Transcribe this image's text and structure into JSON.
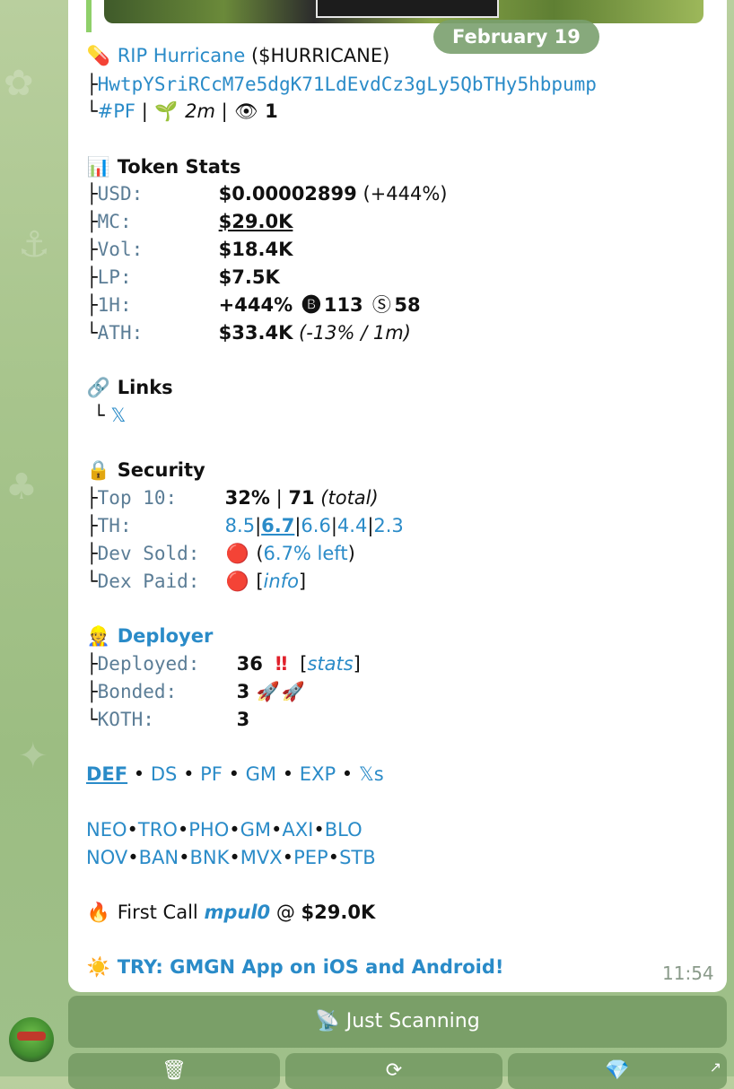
{
  "chat": {
    "date_pill": "February 19",
    "token": {
      "icon": "pill-icon",
      "name": "RIP Hurricane",
      "ticker": "($HURRICANE)",
      "contract_address": "HwtpYSriRCcM7e5dgK71LdEvdCz3gLy5QbTHy5hbpump",
      "platform_tag": "#PF",
      "age": "2m",
      "views": "1"
    },
    "token_stats": {
      "title": "Token Stats",
      "usd_label": "USD:",
      "usd_value": "$0.00002899",
      "usd_change": "(+444%)",
      "mc_label": "MC:",
      "mc_value": "$29.0K",
      "vol_label": "Vol:",
      "vol_value": "$18.4K",
      "lp_label": "LP:",
      "lp_value": "$7.5K",
      "h1_label": "1H:",
      "h1_change": "+444%",
      "h1_buys": "113",
      "h1_sells": "58",
      "ath_label": "ATH:",
      "ath_value": "$33.4K",
      "ath_note": "(-13% / 1m)"
    },
    "links": {
      "title": "Links",
      "x_link": "𝕏"
    },
    "security": {
      "title": "Security",
      "top10_label": "Top 10:",
      "top10_value": "32%",
      "top10_total": "71",
      "top10_total_note": "(total)",
      "th_label": "TH:",
      "th_values": [
        "8.5",
        "6.7",
        "6.6",
        "4.4",
        "2.3"
      ],
      "dev_sold_label": "Dev Sold:",
      "dev_sold_left": "6.7% left",
      "dex_paid_label": "Dex Paid:",
      "dex_paid_info": "info"
    },
    "deployer": {
      "title": "Deployer",
      "deployed_label": "Deployed:",
      "deployed_value": "36",
      "deployed_stats": "stats",
      "bonded_label": "Bonded:",
      "bonded_value": "3",
      "koth_label": "KOTH:",
      "koth_value": "3"
    },
    "quick_links_1": [
      "DEF",
      "DS",
      "PF",
      "GM",
      "EXP",
      "𝕏s"
    ],
    "quick_links_2": [
      "NEO",
      "TRO",
      "PHO",
      "GM",
      "AXI",
      "BLO"
    ],
    "quick_links_3": [
      "NOV",
      "BAN",
      "BNK",
      "MVX",
      "PEP",
      "STB"
    ],
    "first_call": {
      "prefix": "First Call",
      "user": "mpul0",
      "at": "@",
      "value": "$29.0K"
    },
    "promo": "TRY: GMGN App on iOS and Android!",
    "time": "11:54"
  },
  "buttons": {
    "just_scanning": "Just Scanning"
  },
  "colors": {
    "link": "#2a8bc8",
    "label": "#5b7d96",
    "bubble": "#ffffff",
    "wallpaper": "#a8c58d",
    "button": "#70965f"
  }
}
